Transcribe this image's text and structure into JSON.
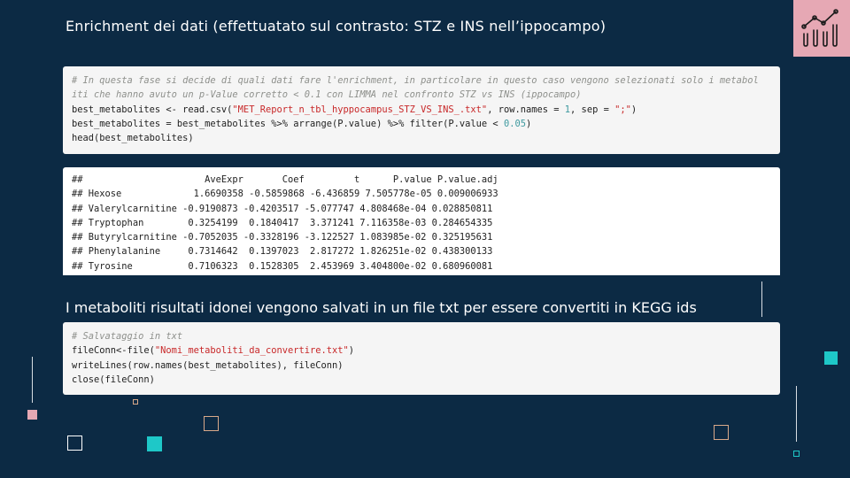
{
  "slide": {
    "title": "Enrichment dei dati (effettuatato sul contrasto: STZ e INS nell’ippocampo)",
    "subtitle": "I metaboliti risultati idonei vengono salvati in un file txt per essere convertiti in KEGG ids",
    "logo_icon": "bar-chart-trend-icon"
  },
  "code1": {
    "comment_line1": "# In questa fase si decide di quali dati fare l'enrichment, in particolare in questo caso vengono selezionati solo i metabol",
    "comment_line2": "iti che hanno avuto un p-Value corretto < 0.1 con LIMMA nel confronto STZ vs INS (ippocampo)",
    "l3_a": "best_metabolites <- read.csv(",
    "l3_str": "\"MET_Report_n_tbl_hyppocampus_STZ_VS_INS_.txt\"",
    "l3_b": ", row.names = ",
    "l3_num": "1",
    "l3_c": ", sep = ",
    "l3_str2": "\";\"",
    "l3_d": ")",
    "l4_a": "best_metabolites = best_metabolites %>% arrange(P.value) %>% filter(P.value < ",
    "l4_num": "0.05",
    "l4_b": ")",
    "l5": "head(best_metabolites)"
  },
  "output1": {
    "lines": [
      "##                      AveExpr       Coef         t      P.value P.value.adj",
      "## Hexose             1.6690358 -0.5859868 -6.436859 7.505778e-05 0.009006933",
      "## Valerylcarnitine -0.9190873 -0.4203517 -5.077747 4.808468e-04 0.028850811",
      "## Tryptophan        0.3254199  0.1840417  3.371241 7.116358e-03 0.284654335",
      "## Butyrylcarnitine -0.7052035 -0.3328196 -3.122527 1.083985e-02 0.325195631",
      "## Phenylalanine     0.7314642  0.1397023  2.817272 1.826251e-02 0.438300133",
      "## Tyrosine          0.7106323  0.1528305  2.453969 3.404800e-02 0.680960081"
    ]
  },
  "code2": {
    "comment": "# Salvataggio in txt",
    "l2_a": "fileConn<-file(",
    "l2_str": "\"Nomi_metaboliti_da_convertire.txt\"",
    "l2_b": ")",
    "l3": "writeLines(row.names(best_metabolites), fileConn)",
    "l4": "close(fileConn)"
  },
  "colors": {
    "background": "#0c2a44",
    "accent_pink": "#e6a8b4",
    "accent_teal": "#1ec8c8",
    "accent_tan": "#d9a98a"
  }
}
